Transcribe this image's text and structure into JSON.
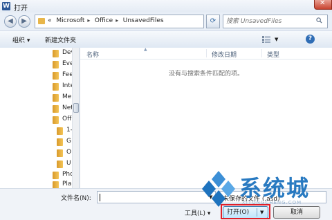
{
  "window": {
    "title": "打开",
    "app_icon_letter": "W"
  },
  "address_bar": {
    "breadcrumb": [
      "«",
      "Microsoft",
      "Office",
      "UnsavedFiles"
    ],
    "search_placeholder": "搜索 UnsavedFiles"
  },
  "toolbar": {
    "organize_label": "组织 ▾",
    "new_folder_label": "新建文件夹"
  },
  "nav_tree": {
    "items": [
      {
        "label": "Dev",
        "indent": 0
      },
      {
        "label": "Eve",
        "indent": 0
      },
      {
        "label": "Fee",
        "indent": 0
      },
      {
        "label": "Inte",
        "indent": 0
      },
      {
        "label": "Me",
        "indent": 0
      },
      {
        "label": "Net",
        "indent": 0
      },
      {
        "label": "Off",
        "indent": 0
      },
      {
        "label": "1-",
        "indent": 1
      },
      {
        "label": "G",
        "indent": 1
      },
      {
        "label": "O",
        "indent": 1
      },
      {
        "label": "U",
        "indent": 1
      },
      {
        "label": "Pho",
        "indent": 0
      },
      {
        "label": "Pla",
        "indent": 0
      }
    ]
  },
  "file_list": {
    "columns": [
      "名称",
      "修改日期",
      "类型"
    ],
    "empty_message": "没有与搜索条件匹配的项。"
  },
  "bottom": {
    "filename_label": "文件名(N):",
    "filename_value": "",
    "filetype_value": "未保存的文件 (.asd)",
    "tools_label": "工具(L) ▾",
    "open_label": "打开(O)",
    "cancel_label": "取消"
  },
  "watermark": {
    "text": "系统城",
    "subtext": "XITONGCHENG.COM"
  },
  "colors": {
    "accent_blue": "#1e73be",
    "highlight_red": "#e0202a"
  }
}
